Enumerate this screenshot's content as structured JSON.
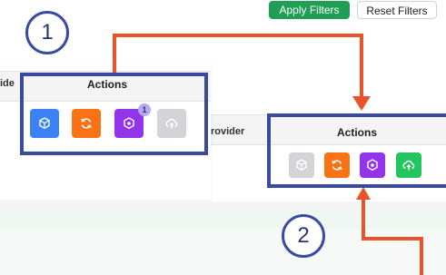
{
  "filters": {
    "apply_label": "Apply Filters",
    "reset_label": "Reset Filters"
  },
  "panel_1": {
    "step_number": "1",
    "provider_header_partial": "ide",
    "actions_header": "Actions",
    "badge_count": "1",
    "buttons": [
      {
        "icon": "cube-plus-icon",
        "color": "#3b82f6"
      },
      {
        "icon": "refresh-icon",
        "color": "#f97316"
      },
      {
        "icon": "cube-settings-icon",
        "color": "#9333ea"
      },
      {
        "icon": "cloud-upload-icon",
        "color": "#d4d4d8"
      }
    ]
  },
  "panel_2": {
    "step_number": "2",
    "provider_header_partial": "rovider",
    "actions_header": "Actions",
    "buttons": [
      {
        "icon": "cube-plus-icon",
        "color": "#d4d4d8"
      },
      {
        "icon": "refresh-icon",
        "color": "#f97316"
      },
      {
        "icon": "cube-settings-icon",
        "color": "#9333ea"
      },
      {
        "icon": "cloud-upload-icon",
        "color": "#22c55e"
      }
    ]
  },
  "colors": {
    "frame": "#3a4aa0",
    "arrow": "#e8552a",
    "apply_button": "#1f9f54"
  }
}
